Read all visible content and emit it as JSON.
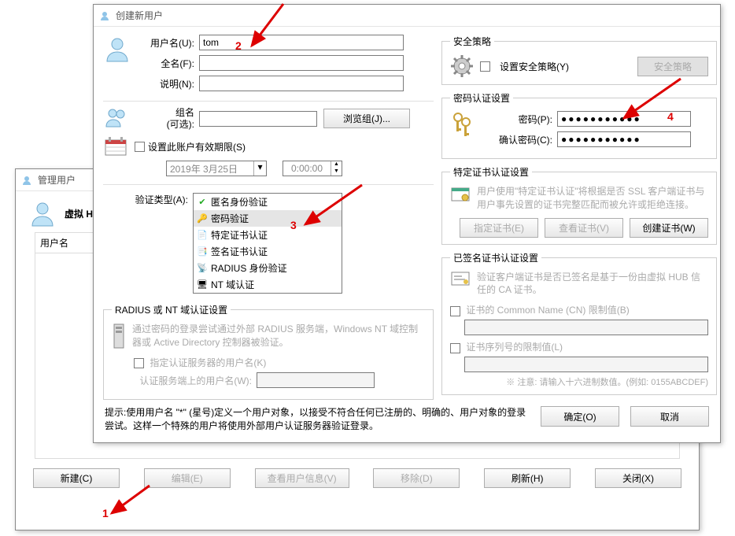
{
  "annotations": {
    "n1": "1",
    "n2": "2",
    "n3": "3",
    "n4": "4"
  },
  "mgr": {
    "title": "管理用户",
    "vhub_label": "虚拟 HUB",
    "col_username": "用户名",
    "btn_new": "新建(C)",
    "btn_edit": "编辑(E)",
    "btn_view": "查看用户信息(V)",
    "btn_remove": "移除(D)",
    "btn_refresh": "刷新(H)",
    "btn_close": "关闭(X)"
  },
  "dlg": {
    "title": "创建新用户",
    "username_label": "用户名(U):",
    "username_value": "tom",
    "fullname_label": "全名(F):",
    "desc_label": "说明(N):",
    "group_label1": "组名",
    "group_label2": "(可选):",
    "browse_group": "浏览组(J)...",
    "set_expiry": "设置此账户有效期限(S)",
    "date_value": "2019年 3月25日",
    "time_value": "0:00:00",
    "auth_type_label": "验证类型(A):",
    "auth_items": [
      "匿名身份验证",
      "密码验证",
      "特定证书认证",
      "签名证书认证",
      "RADIUS 身份验证",
      "NT 域认证"
    ],
    "radius_frame": "RADIUS 或 NT 域认证设置",
    "radius_desc": "通过密码的登录尝试通过外部 RADIUS 服务端，Windows NT 域控制器或 Active Directory 控制器被验证。",
    "radius_chk": "指定认证服务器的用户名(K)",
    "radius_field": "认证服务端上的用户名(W):",
    "sec_policy_frame": "安全策略",
    "sec_policy_chk": "设置安全策略(Y)",
    "sec_policy_btn": "安全策略",
    "pwd_frame": "密码认证设置",
    "pwd_label": "密码(P):",
    "pwd_confirm_label": "确认密码(C):",
    "pwd_value": "●●●●●●●●●●●",
    "cert_frame": "特定证书认证设置",
    "cert_desc": "用户使用\"特定证书认证\"将根据是否 SSL 客户端证书与用户事先设置的证书完整匹配而被允许或拒绝连接。",
    "cert_btn_spec": "指定证书(E)",
    "cert_btn_view": "查看证书(V)",
    "cert_btn_create": "创建证书(W)",
    "signed_frame": "已签名证书认证设置",
    "signed_desc": "验证客户端证书是否已签名是基于一份由虚拟 HUB 信任的 CA 证书。",
    "signed_chk_cn": "证书的 Common Name (CN) 限制值(B)",
    "signed_chk_sn": "证书序列号的限制值(L)",
    "signed_note": "※ 注意: 请输入十六进制数值。(例如: 0155ABCDEF)",
    "hint": "提示:使用用户名 \"*\" (星号)定义一个用户对象，以接受不符合任何已注册的、明确的、用户对象的登录尝试。这样一个特殊的用户将使用外部用户认证服务器验证登录。",
    "btn_ok": "确定(O)",
    "btn_cancel": "取消"
  }
}
